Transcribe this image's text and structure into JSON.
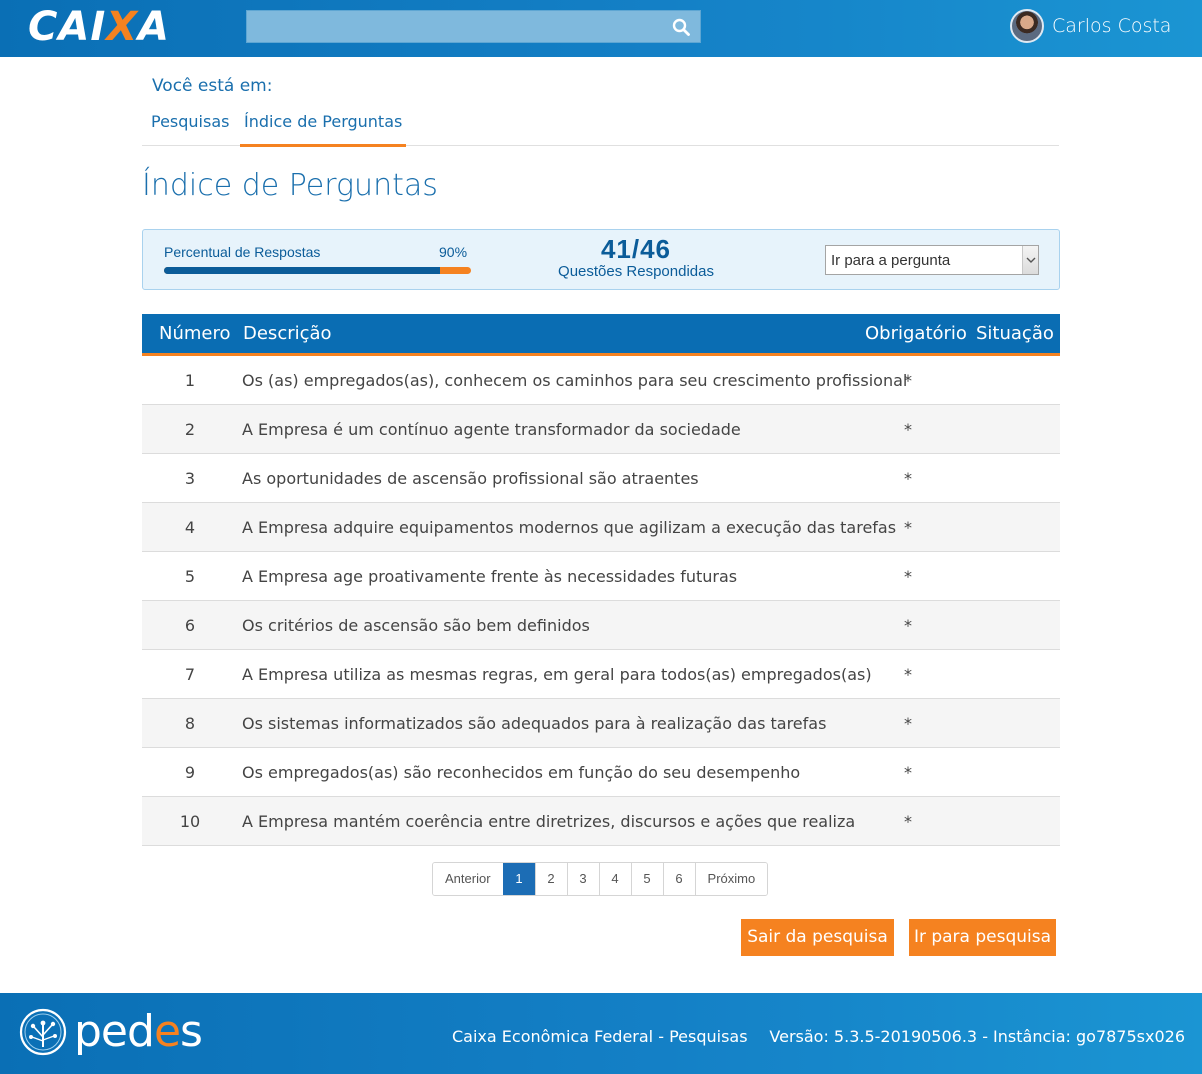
{
  "header": {
    "brand": {
      "pre": "CAI",
      "x": "X",
      "post": "A"
    },
    "search": {
      "placeholder": ""
    },
    "user_name": "Carlos Costa"
  },
  "breadcrumb": {
    "lead": "Você está em:",
    "items": [
      "Pesquisas",
      "Índice de Perguntas"
    ],
    "active_index": 1
  },
  "page_title": "Índice de Perguntas",
  "stats": {
    "percent_label": "Percentual de Respostas",
    "percent_value": "90%",
    "progress_fraction": 0.9,
    "count": "41/46",
    "count_label": "Questões Respondidas",
    "goto_label": "Ir para a pergunta"
  },
  "table": {
    "headers": {
      "numero": "Número",
      "descricao": "Descrição",
      "obrigatorio": "Obrigatório",
      "situacao": "Situação"
    },
    "rows": [
      {
        "numero": "1",
        "descricao": "Os (as) empregados(as), conhecem os caminhos para seu crescimento profissional",
        "obrigatorio": "*",
        "situacao": ""
      },
      {
        "numero": "2",
        "descricao": "A Empresa é um contínuo agente transformador da sociedade",
        "obrigatorio": "*",
        "situacao": ""
      },
      {
        "numero": "3",
        "descricao": "As oportunidades de ascensão profissional são atraentes",
        "obrigatorio": "*",
        "situacao": ""
      },
      {
        "numero": "4",
        "descricao": "A Empresa adquire equipamentos modernos que agilizam a execução das tarefas",
        "obrigatorio": "*",
        "situacao": ""
      },
      {
        "numero": "5",
        "descricao": "A Empresa age proativamente frente às necessidades futuras",
        "obrigatorio": "*",
        "situacao": ""
      },
      {
        "numero": "6",
        "descricao": "Os critérios de ascensão são bem definidos",
        "obrigatorio": "*",
        "situacao": ""
      },
      {
        "numero": "7",
        "descricao": "A Empresa utiliza as mesmas regras, em geral para todos(as) empregados(as)",
        "obrigatorio": "*",
        "situacao": ""
      },
      {
        "numero": "8",
        "descricao": "Os sistemas informatizados são adequados para à realização das tarefas",
        "obrigatorio": "*",
        "situacao": ""
      },
      {
        "numero": "9",
        "descricao": "Os empregados(as) são reconhecidos em função do seu desempenho",
        "obrigatorio": "*",
        "situacao": ""
      },
      {
        "numero": "10",
        "descricao": "A Empresa mantém coerência entre diretrizes, discursos e ações que realiza",
        "obrigatorio": "*",
        "situacao": ""
      }
    ]
  },
  "pagination": {
    "previous": "Anterior",
    "pages": [
      "1",
      "2",
      "3",
      "4",
      "5",
      "6"
    ],
    "current": "1",
    "next": "Próximo"
  },
  "actions": {
    "exit": "Sair da pesquisa",
    "go": "Ir para pesquisa"
  },
  "footer": {
    "brand": {
      "pre": "ped",
      "accent": "e",
      "post": "s"
    },
    "center": "Caixa Econômica Federal - Pesquisas",
    "right": "Versão: 5.3.5-20190506.3 - Instância: go7875sx026"
  },
  "colors": {
    "primary": "#0a6db3",
    "accent": "#f58220",
    "panel_bg": "#e7f3fb"
  },
  "icons": {
    "search": "search-icon",
    "dropdown": "chevron-down-icon",
    "footer_logo": "tree-circle-icon"
  }
}
